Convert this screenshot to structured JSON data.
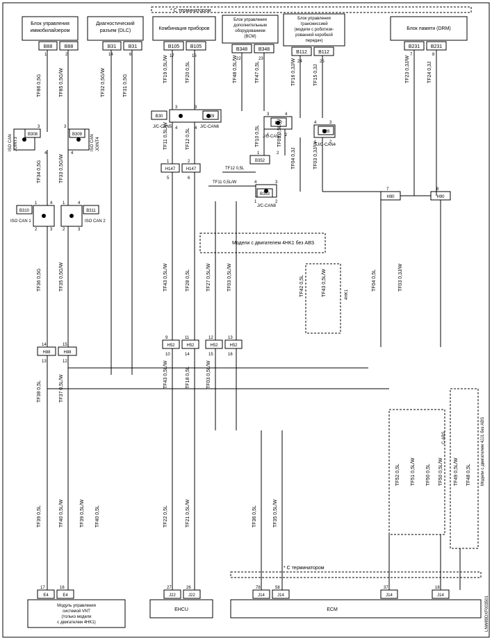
{
  "title_top": "С терминатором",
  "title_bottom": "С терминатором",
  "watermark": "LNW89DXF003501",
  "boxes": {
    "b1": {
      "l1": "Блок управления",
      "l2": "иммобилайзером"
    },
    "b2": {
      "l1": "Диагностический",
      "l2": "разъем (DLC)"
    },
    "b3": {
      "l1": "Комбинация приборов"
    },
    "b4": {
      "l1": "Блок управления",
      "l2": "дополнительным",
      "l3": "оборудованием",
      "l4": "(BCM)"
    },
    "b5": {
      "l1": "Блок управления",
      "l2": "трансмиссией",
      "l3": "(модели с роботизи-",
      "l4": "рованной коробкой",
      "l5": "передач)"
    },
    "b6": {
      "l1": "Блок памяти (DRM)"
    }
  },
  "connectors": {
    "B88a": "B88",
    "B88b": "B88",
    "B31a": "B31",
    "B31b": "B31",
    "B105a": "B105",
    "B105b": "B105",
    "B348a": "B348",
    "B348b": "B348",
    "B112a": "B112",
    "B112b": "B112",
    "B231": "B231",
    "B231b": "B231",
    "B308": "B308",
    "B309": "B309",
    "B310": "B310",
    "B311": "B311",
    "B30": "B30",
    "B29": "B29",
    "B27": "B27",
    "B28": "B28",
    "B352": "B352",
    "B353": "B353",
    "H90a": "H90",
    "H90b": "H90",
    "H88a": "H88",
    "H88b": "H88",
    "H147a": "H147",
    "H147b": "H147",
    "H52a": "H52",
    "H52b": "H52",
    "H52c": "H52",
    "H52d": "H52",
    "E4a": "E4",
    "E4b": "E4",
    "J22a": "J22",
    "J22b": "J22",
    "J14a": "J14",
    "J14b": "J14",
    "J14c": "J14",
    "J14d": "J14"
  },
  "labels": {
    "iso1": "ISO CAN",
    "iso1b": "JOINT3",
    "iso2": "ISO CAN",
    "iso2b": "JOINT4",
    "iso3": "ISO CAN 1",
    "iso4": "ISO CAN 2",
    "jc5": "J/C-CAN5",
    "jc6": "J/C-CAN6",
    "jc7": "J/C-CAN7",
    "jc8": "J/C-CAN8",
    "jc4": "J/C-CAN4",
    "ehcu": "EHCU",
    "ecm": "ECM",
    "vnt1": "Модуль управления",
    "vnt2": "системой VNT",
    "vnt3": "(только модели",
    "vnt4": "с двигателем 4HK1)",
    "m4hk1": "Модели с двигателем 4HK1 без ABS",
    "m4jj1": "Модели с двигателем 4JJ1 без ABS",
    "m4hk1b": "4HK1",
    "cabs": "С·ABS"
  },
  "wires": {
    "TF86": "TF86 0,5G",
    "TF85": "TF85 0,5G/W",
    "TF34": "TF34 0,5G",
    "TF33": "TF33 0,5G/W",
    "TF36": "TF36 0,5G",
    "TF35": "TF35 0,5G/W",
    "TF38": "TF38 0,5L",
    "TF37": "TF37 0,5L/W",
    "TF32": "TF32 0,5G/W",
    "TF31": "TF31 0,5G",
    "TF19": "TF19 0,5L/W",
    "TF20": "TF20 0,5L",
    "TF48": "TF48 0,5L/W",
    "TF47": "TF47 0,5L",
    "TF16": "TF16 0,3J/W",
    "TF15": "TF15 0,3J",
    "TF23": "TF23 0,3J/W",
    "TF24": "TF24 0,3J",
    "TF11a": "TF11 0,5L/W",
    "TF12a": "TF12 0,5L",
    "TF10": "TF10 0,5L",
    "TF09": "TF09 0,5L/W",
    "TF04": "TF04 0,3J",
    "TF03": "TF03 0,3J/W",
    "TF12b": "TF12 0,5L",
    "TF11b": "TF11 0,5L/W",
    "TF43a": "TF43 0,5L/W",
    "TF28": "TF28 0,5L",
    "TF27": "TF27 0,5L/W",
    "TF03b": "TF03 0,5L/W",
    "TF04b": "TF04 0,5L",
    "TF42": "TF42 0,5L",
    "TF43b": "TF43 0,5L/W",
    "TF43c": "TF43 0,5L/W",
    "TF18": "TF18 0,5L",
    "TF03c": "TF03 0,5L/W",
    "TF22": "TF22 0,5L",
    "TF21": "TF21 0,5L/W",
    "TF36b": "TF36 0,5L",
    "TF35b": "TF35 0,5L/W",
    "TF39": "TF39 0,5L",
    "TF40": "TF40 0,5L/W",
    "TF39b": "TF39 0,5L/W",
    "TF40b": "TF40 0,5L",
    "TF52": "TF52 0,5L",
    "TF51": "TF51 0,5L/W",
    "TF50a": "TF50 0,5L/W",
    "TF50b": "TF50 0,5L",
    "TF49": "TF49 0,5L/W",
    "TF48b": "TF48 0,5L"
  },
  "pins": {
    "p1": "1",
    "p2": "2",
    "p3": "3",
    "p4": "4",
    "p5": "5",
    "p6": "6",
    "p7": "7",
    "p8": "8",
    "p9": "9",
    "p10": "10",
    "p11": "11",
    "p12": "12",
    "p13": "13",
    "p14": "14",
    "p15": "15",
    "p16": "16",
    "p17": "17",
    "p18": "18",
    "p22": "22",
    "p23": "23",
    "p24": "24",
    "p25": "25",
    "p26": "26",
    "p27": "27",
    "p37": "37",
    "p58": "58",
    "p78": "78"
  }
}
